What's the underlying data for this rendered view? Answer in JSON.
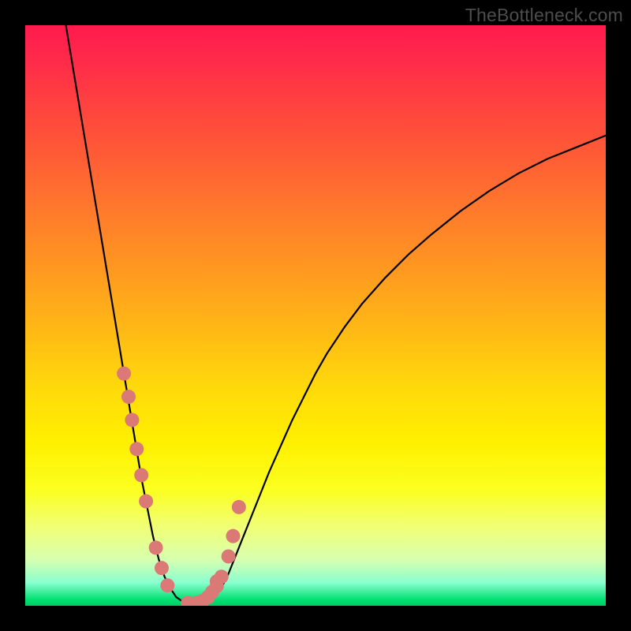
{
  "watermark": {
    "text": "TheBottleneck.com"
  },
  "chart_data": {
    "type": "line",
    "title": "",
    "xlabel": "",
    "ylabel": "",
    "xlim": [
      0,
      100
    ],
    "ylim": [
      0,
      100
    ],
    "grid": false,
    "legend": false,
    "background": "rainbow_vertical_gradient",
    "series": [
      {
        "name": "bottleneck-curve",
        "color": "#000000",
        "x": [
          7,
          8,
          9,
          10,
          11,
          12,
          13,
          14,
          15,
          16,
          17,
          18,
          19,
          20,
          21,
          22,
          23,
          24,
          25,
          26,
          27,
          28,
          29,
          30,
          31,
          32,
          33,
          34,
          35,
          36,
          37,
          38,
          40,
          42,
          44,
          46,
          48,
          50,
          52,
          55,
          58,
          62,
          66,
          70,
          75,
          80,
          85,
          90,
          95,
          100
        ],
        "y": [
          100,
          94,
          88,
          82,
          76,
          70,
          64,
          58,
          52,
          46,
          40,
          34,
          28,
          22,
          17,
          12,
          8,
          5,
          3,
          1.5,
          0.8,
          0.4,
          0.3,
          0.3,
          0.5,
          1,
          2,
          3.5,
          5.5,
          8,
          10.5,
          13,
          18,
          23,
          27.5,
          32,
          36,
          40,
          43.5,
          48,
          52,
          56.5,
          60.5,
          64,
          68,
          71.5,
          74.5,
          77,
          79,
          81
        ]
      }
    ],
    "markers": [
      {
        "name": "scatter-points",
        "color": "#db7977",
        "radius_px": 9,
        "x": [
          17.0,
          17.8,
          18.4,
          19.2,
          20.0,
          20.8,
          22.5,
          23.5,
          24.5,
          28.0,
          29.5,
          30.5,
          31.5,
          32.2,
          33.0,
          33.8,
          35.0,
          35.8,
          36.8,
          33.0
        ],
        "y": [
          40,
          36,
          32,
          27,
          22.5,
          18,
          10,
          6.5,
          3.5,
          0.5,
          0.5,
          0.8,
          1.5,
          2.4,
          3.4,
          5,
          8.5,
          12,
          17,
          4.2
        ]
      }
    ]
  }
}
